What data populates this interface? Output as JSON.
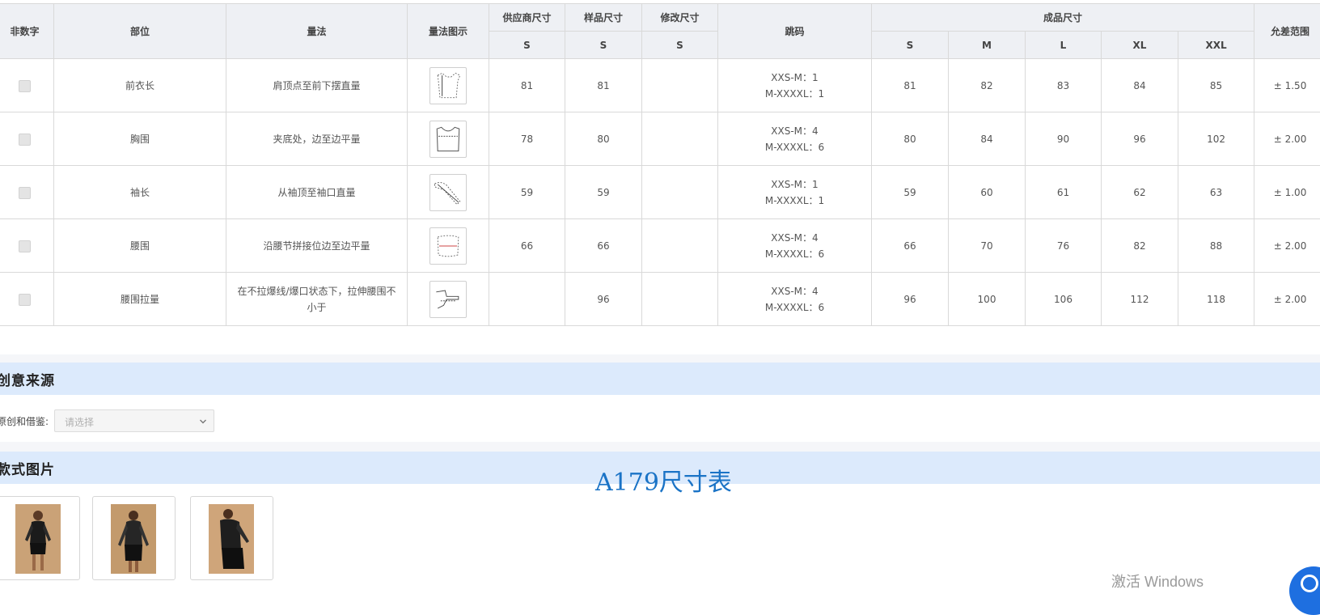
{
  "table": {
    "headers": {
      "non_numeric": "非数字",
      "part": "部位",
      "method": "量法",
      "method_diagram": "量法图示",
      "supplier_size": "供应商尺寸",
      "sample_size": "样品尺寸",
      "modified_size": "修改尺寸",
      "jump": "跳码",
      "finished_size": "成品尺寸",
      "tolerance": "允差范围",
      "supplier_sub": "S",
      "sample_sub": "S",
      "modified_sub": "S",
      "sizes": [
        "S",
        "M",
        "L",
        "XL",
        "XXL"
      ]
    },
    "rows": [
      {
        "part": "前衣长",
        "method": "肩顶点至前下摆直量",
        "diagram_icon": "front-length-diagram-icon",
        "supplier": "81",
        "sample": "81",
        "modified": "",
        "jump1": "XXS-M：1",
        "jump2": "M-XXXXL：1",
        "s": "81",
        "m": "82",
        "l": "83",
        "xl": "84",
        "xxl": "85",
        "tolerance": "± 1.50"
      },
      {
        "part": "胸围",
        "method": "夹底处，边至边平量",
        "diagram_icon": "chest-diagram-icon",
        "supplier": "78",
        "sample": "80",
        "modified": "",
        "jump1": "XXS-M：4",
        "jump2": "M-XXXXL：6",
        "s": "80",
        "m": "84",
        "l": "90",
        "xl": "96",
        "xxl": "102",
        "tolerance": "± 2.00"
      },
      {
        "part": "袖长",
        "method": "从袖顶至袖口直量",
        "diagram_icon": "sleeve-diagram-icon",
        "supplier": "59",
        "sample": "59",
        "modified": "",
        "jump1": "XXS-M：1",
        "jump2": "M-XXXXL：1",
        "s": "59",
        "m": "60",
        "l": "61",
        "xl": "62",
        "xxl": "63",
        "tolerance": "± 1.00"
      },
      {
        "part": "腰围",
        "method": "沿腰节拼接位边至边平量",
        "diagram_icon": "waist-diagram-icon",
        "supplier": "66",
        "sample": "66",
        "modified": "",
        "jump1": "XXS-M：4",
        "jump2": "M-XXXXL：6",
        "s": "66",
        "m": "70",
        "l": "76",
        "xl": "82",
        "xxl": "88",
        "tolerance": "± 2.00"
      },
      {
        "part": "腰围拉量",
        "method": "在不拉爆线/爆口状态下，拉伸腰围不小于",
        "diagram_icon": "waist-stretch-diagram-icon",
        "supplier": "",
        "sample": "96",
        "modified": "",
        "jump1": "XXS-M：4",
        "jump2": "M-XXXXL：6",
        "s": "96",
        "m": "100",
        "l": "106",
        "xl": "112",
        "xxl": "118",
        "tolerance": "± 2.00"
      }
    ]
  },
  "creative_source": {
    "title": "创意来源",
    "field_label": "原创和借鉴:",
    "placeholder": "请选择"
  },
  "style_images": {
    "title": "款式图片",
    "items": [
      {
        "name": "style-photo-1"
      },
      {
        "name": "style-photo-2"
      },
      {
        "name": "style-photo-3"
      }
    ]
  },
  "caption": "A179尺寸表",
  "windows_activation": "激活 Windows",
  "colors": {
    "header_bg": "#eef0f4",
    "section_bar": "#dceafc",
    "caption_blue": "#1a73c6",
    "photo_bg": "#c9a276"
  }
}
